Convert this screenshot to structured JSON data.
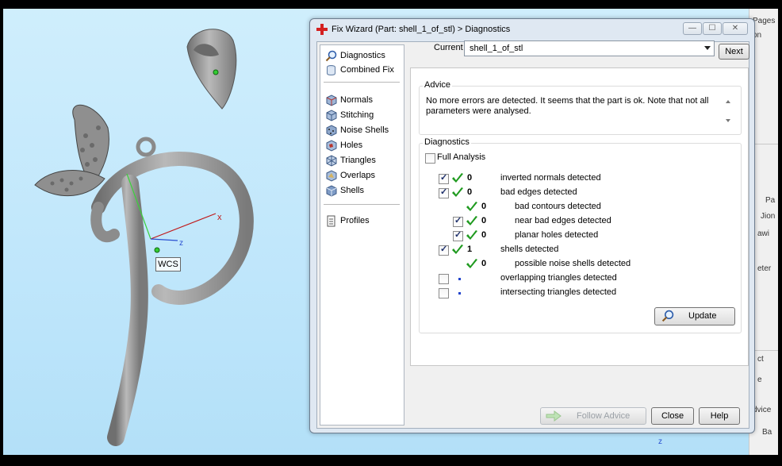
{
  "dialog": {
    "title": "Fix Wizard (Part: shell_1_of_stl) > Diagnostics",
    "window_buttons": [
      "—",
      "☐",
      "✕"
    ]
  },
  "viewport": {
    "wcs_label": "WCS",
    "axis_x": "x",
    "axis_z": "z"
  },
  "side_panel_fragments": [
    "Pages",
    "on",
    "Pa",
    "Jion",
    "awi",
    "eter",
    "ct",
    "e",
    "dvice",
    "Ba"
  ],
  "nav": {
    "items": [
      {
        "label": "Diagnostics",
        "icon": "magnifier-icon",
        "active": true
      },
      {
        "label": "Combined Fix",
        "icon": "cylinder-icon"
      },
      {
        "label": "Normals",
        "icon": "normals-icon"
      },
      {
        "label": "Stitching",
        "icon": "stitching-icon"
      },
      {
        "label": "Noise Shells",
        "icon": "noise-shells-icon"
      },
      {
        "label": "Holes",
        "icon": "holes-icon"
      },
      {
        "label": "Triangles",
        "icon": "triangles-icon"
      },
      {
        "label": "Overlaps",
        "icon": "overlaps-icon"
      },
      {
        "label": "Shells",
        "icon": "shells-icon"
      },
      {
        "label": "Profiles",
        "icon": "profiles-icon"
      }
    ]
  },
  "current_part": {
    "label": "Current Part:",
    "value": "shell_1_of_stl",
    "next_label": "Next"
  },
  "advice": {
    "title": "Advice",
    "text": "No more errors are detected. It seems that the part is ok. Note that not all parameters were analysed."
  },
  "diagnostics": {
    "title": "Diagnostics",
    "full_analysis_label": "Full Analysis",
    "rows": [
      {
        "checked": true,
        "tick": true,
        "count": "0",
        "label": "inverted normals detected",
        "indent": 0
      },
      {
        "checked": true,
        "tick": true,
        "count": "0",
        "label": "bad edges detected",
        "indent": 0
      },
      {
        "checked": null,
        "tick": true,
        "count": "0",
        "label": "bad contours detected",
        "indent": 1
      },
      {
        "checked": true,
        "tick": true,
        "count": "0",
        "label": "near bad edges detected",
        "indent": 1
      },
      {
        "checked": true,
        "tick": true,
        "count": "0",
        "label": "planar holes detected",
        "indent": 1
      },
      {
        "checked": true,
        "tick": true,
        "count": "1",
        "label": "shells detected",
        "indent": 0
      },
      {
        "checked": null,
        "tick": true,
        "count": "0",
        "label": "possible noise shells detected",
        "indent": 1
      },
      {
        "checked": false,
        "tick": false,
        "count": "",
        "label": "overlapping triangles detected",
        "indent": 0
      },
      {
        "checked": false,
        "tick": false,
        "count": "",
        "label": "intersecting triangles detected",
        "indent": 0
      }
    ],
    "update_label": "Update"
  },
  "footer": {
    "follow_advice_label": "Follow Advice",
    "close_label": "Close",
    "help_label": "Help"
  },
  "colors": {
    "tick_green": "#1f9a1f",
    "model_gray": "#8d8d8d",
    "viewport_blue": "#c6eafc"
  }
}
